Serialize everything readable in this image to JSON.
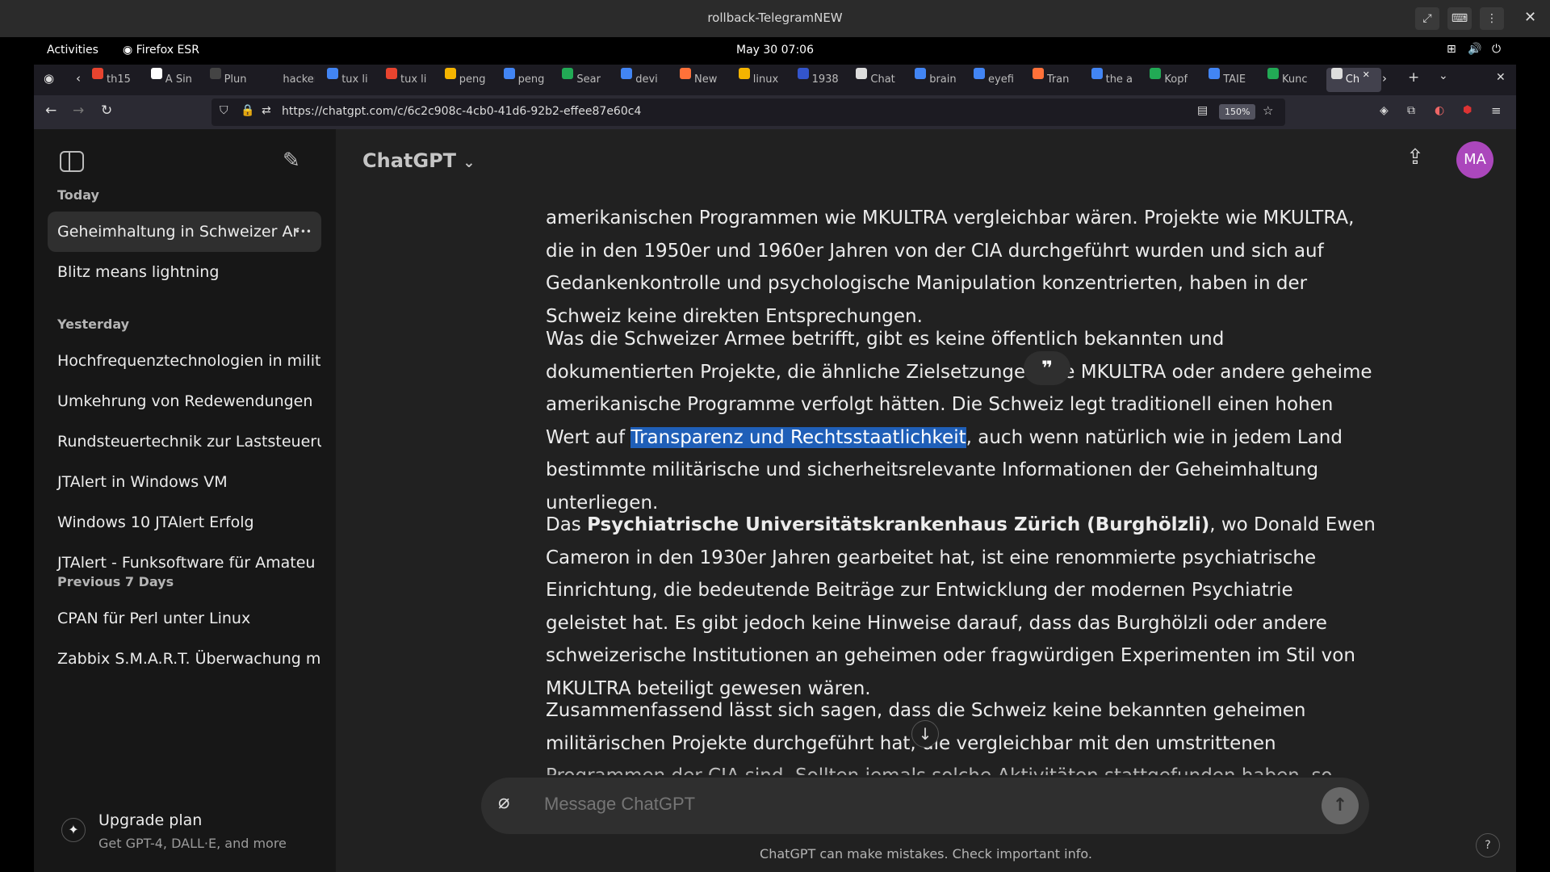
{
  "window": {
    "title": "rollback-TelegramNEW"
  },
  "gnome": {
    "activities": "Activities",
    "app": "Firefox ESR",
    "clock": "May 30  07:06"
  },
  "browser": {
    "tabs": [
      {
        "label": "th15",
        "color": "#e8442f"
      },
      {
        "label": "A Sin",
        "color": "#ffffff"
      },
      {
        "label": "Plun",
        "color": "#444444"
      },
      {
        "label": "hackers",
        "color": "#1c1b22"
      },
      {
        "label": "tux li",
        "color": "#4285f4"
      },
      {
        "label": "tux li",
        "color": "#e8442f"
      },
      {
        "label": "peng",
        "color": "#f4b400"
      },
      {
        "label": "peng",
        "color": "#4285f4"
      },
      {
        "label": "Sear",
        "color": "#22aa55"
      },
      {
        "label": "devi",
        "color": "#4285f4"
      },
      {
        "label": "New",
        "color": "#ff7139"
      },
      {
        "label": "linux",
        "color": "#f4b400"
      },
      {
        "label": "1938",
        "color": "#3355cc"
      },
      {
        "label": "Chat",
        "color": "#dddddd"
      },
      {
        "label": "brain",
        "color": "#4285f4"
      },
      {
        "label": "eyefi",
        "color": "#4285f4"
      },
      {
        "label": "Tran",
        "color": "#ff7139"
      },
      {
        "label": "the a",
        "color": "#4285f4"
      },
      {
        "label": "Kopf",
        "color": "#22aa55"
      },
      {
        "label": "TAIE",
        "color": "#4285f4"
      },
      {
        "label": "Kunc",
        "color": "#22aa55"
      },
      {
        "label": "Ch",
        "color": "#dddddd"
      }
    ],
    "url": "https://chatgpt.com/c/6c2c908c-4cb0-41d6-92b2-effee87e60c4",
    "zoom": "150%"
  },
  "sidebar": {
    "sections": [
      {
        "heading": "Today",
        "items": [
          "Geheimhaltung in Schweizer Ar",
          "Blitz means lightning"
        ]
      },
      {
        "heading": "Yesterday",
        "items": [
          "Hochfrequenztechnologien in milit",
          "Umkehrung von Redewendungen",
          "Rundsteuertechnik zur Laststeueru",
          "JTAlert in Windows VM",
          "Windows 10 JTAlert Erfolg",
          "JTAlert - Funksoftware für Amateu"
        ]
      },
      {
        "heading": "Previous 7 Days",
        "items": [
          "CPAN für Perl unter Linux",
          "Zabbix S.M.A.R.T. Überwachung mi"
        ]
      }
    ],
    "upgrade_title": "Upgrade plan",
    "upgrade_sub": "Get GPT-4, DALL·E, and more"
  },
  "header": {
    "model": "ChatGPT",
    "avatar": "MA"
  },
  "message": {
    "p1": "amerikanischen Programmen wie MKULTRA vergleichbar wären. Projekte wie MKULTRA, die in den 1950er und 1960er Jahren von der CIA durchgeführt wurden und sich auf Gedankenkontrolle und psychologische Manipulation konzentrierten, haben in der Schweiz keine direkten Entsprechungen.",
    "p2_a": "Was die Schweizer Armee betrifft, gibt es keine öffentlich bekannten und dokumentierten Projekte, die ähnliche Zielsetzungen wie MKULTRA oder andere geheime amerikanische Programme verfolgt hätten. Die Schweiz legt traditionell einen hohen Wert auf ",
    "p2_highlight": "Transparenz und Rechtsstaatlichkeit",
    "p2_b": ", auch wenn natürlich wie in jedem Land bestimmte militärische und sicherheitsrelevante Informationen der Geheimhaltung unterliegen.",
    "p3_a": "Das ",
    "p3_bold": "Psychiatrische Universitätskrankenhaus Zürich (Burghölzli)",
    "p3_b": ", wo Donald Ewen Cameron in den 1930er Jahren gearbeitet hat, ist eine renommierte psychiatrische Einrichtung, die bedeutende Beiträge zur Entwicklung der modernen Psychiatrie geleistet hat. Es gibt jedoch keine Hinweise darauf, dass das Burghölzli oder andere schweizerische Institutionen an geheimen oder fragwürdigen Experimenten im Stil von MKULTRA beteiligt gewesen wären.",
    "p4": "Zusammenfassend lässt sich sagen, dass die Schweiz keine bekannten geheimen militärischen Projekte durchgeführt hat, die vergleichbar mit den umstrittenen Programmen der CIA sind. Sollten jemals solche Aktivitäten stattgefunden haben, so wären diese extrem gut verborgen und bisher"
  },
  "composer": {
    "placeholder": "Message ChatGPT"
  },
  "footer": {
    "disclaimer": "ChatGPT can make mistakes. Check important info.",
    "help": "?"
  },
  "colors": {
    "accent_avatar": "#ab47bc",
    "highlight": "#1f5fb8"
  }
}
